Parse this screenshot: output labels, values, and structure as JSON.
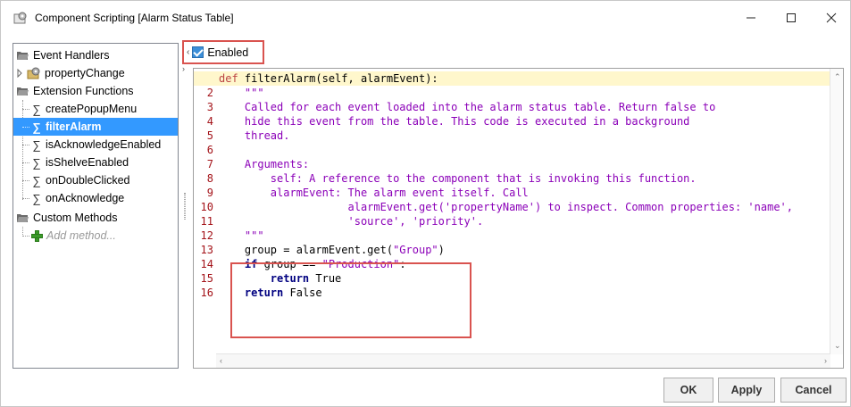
{
  "window": {
    "title": "Component Scripting [Alarm Status Table]",
    "controls": {
      "minimize": "—",
      "maximize": "☐",
      "close": "✕"
    }
  },
  "tree": {
    "event_handlers": "Event Handlers",
    "property_change": "propertyChange",
    "extension_functions": "Extension Functions",
    "functions": [
      "createPopupMenu",
      "filterAlarm",
      "isAcknowledgeEnabled",
      "isShelveEnabled",
      "onDoubleClicked",
      "onAcknowledge"
    ],
    "selected": "filterAlarm",
    "custom_methods": "Custom Methods",
    "add_method": "Add method..."
  },
  "toolbar": {
    "enabled_label": "Enabled",
    "enabled_checked": true
  },
  "editor": {
    "lines": [
      {
        "n": "",
        "text": "def filterAlarm(self, alarmEvent):"
      },
      {
        "n": "2",
        "text": "    \"\"\""
      },
      {
        "n": "3",
        "text": "    Called for each event loaded into the alarm status table. Return false to"
      },
      {
        "n": "4",
        "text": "    hide this event from the table. This code is executed in a background"
      },
      {
        "n": "5",
        "text": "    thread."
      },
      {
        "n": "6",
        "text": ""
      },
      {
        "n": "7",
        "text": "    Arguments:"
      },
      {
        "n": "8",
        "text": "        self: A reference to the component that is invoking this function."
      },
      {
        "n": "9",
        "text": "        alarmEvent: The alarm event itself. Call"
      },
      {
        "n": "10",
        "text": "                    alarmEvent.get('propertyName') to inspect. Common properties: 'name',"
      },
      {
        "n": "11",
        "text": "                    'source', 'priority'."
      },
      {
        "n": "12",
        "text": "    \"\"\""
      },
      {
        "n": "13",
        "text": "    group = alarmEvent.get(\"Group\")"
      },
      {
        "n": "14",
        "text": "    if group == \"Production\":"
      },
      {
        "n": "15",
        "text": "        return True"
      },
      {
        "n": "16",
        "text": "    return False"
      }
    ]
  },
  "buttons": {
    "ok": "OK",
    "apply": "Apply",
    "cancel": "Cancel"
  },
  "colors": {
    "highlight_border": "#d9534f",
    "selection": "#3399ff",
    "current_line": "#fff7cc",
    "docstring": "#8b00b8",
    "keyword": "#000080"
  }
}
